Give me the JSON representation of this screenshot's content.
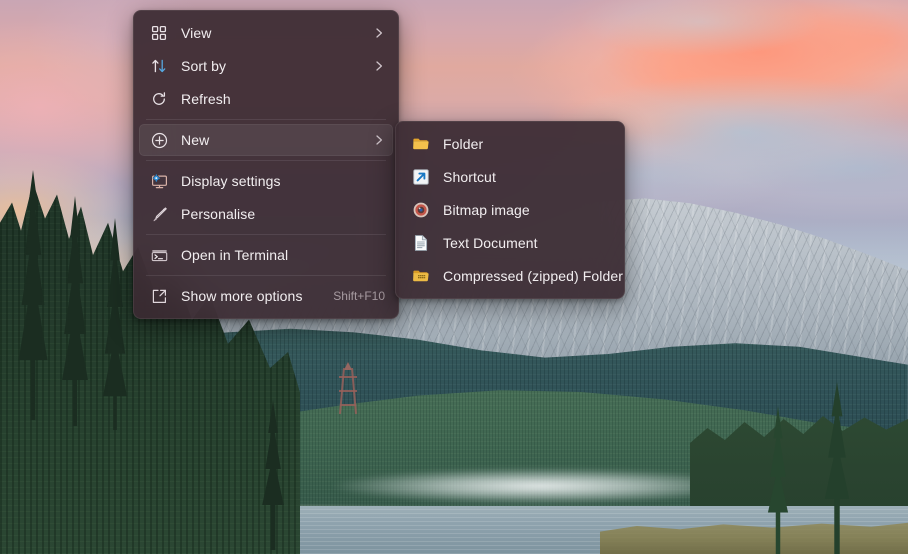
{
  "wallpaper": {
    "scene_name": "alpine-lake-sunset-wallpaper",
    "sky_colors": [
      "#d6a8ad",
      "#ff9a7a",
      "#a6b6c8",
      "#dde2e5"
    ],
    "mountain_color": "#b8c0c8",
    "forest_color": "#22382a",
    "lake_color": "#8fa3ae"
  },
  "colors": {
    "menu_background": "#3a2a32",
    "menu_text": "#f2eef0",
    "menu_accel_text": "#a79ba1",
    "menu_separator": "#4c3c44",
    "selected_row": "#4a3841",
    "accent_blue": "#2f8fd8",
    "folder_yellow": "#f0c04a"
  },
  "context_menu": {
    "name": "desktop-context-menu",
    "items": [
      {
        "id": "view",
        "label": "View",
        "icon": "grid-icon",
        "submenu": true,
        "accel": "",
        "selected": false
      },
      {
        "id": "sort-by",
        "label": "Sort by",
        "icon": "sort-arrows-icon",
        "submenu": true,
        "accel": "",
        "selected": false
      },
      {
        "id": "refresh",
        "label": "Refresh",
        "icon": "refresh-icon",
        "submenu": false,
        "accel": "",
        "selected": false
      },
      {
        "id": "new",
        "label": "New",
        "icon": "plus-circle-icon",
        "submenu": true,
        "accel": "",
        "selected": true
      },
      {
        "id": "display-settings",
        "label": "Display settings",
        "icon": "monitor-gear-icon",
        "submenu": false,
        "accel": "",
        "selected": false
      },
      {
        "id": "personalise",
        "label": "Personalise",
        "icon": "paintbrush-icon",
        "submenu": false,
        "accel": "",
        "selected": false
      },
      {
        "id": "open-in-terminal",
        "label": "Open in Terminal",
        "icon": "terminal-icon",
        "submenu": false,
        "accel": "",
        "selected": false
      },
      {
        "id": "show-more-options",
        "label": "Show more options",
        "icon": "expand-arrow-icon",
        "submenu": false,
        "accel": "Shift+F10",
        "selected": false
      }
    ],
    "separators_after": [
      "refresh",
      "new",
      "personalise",
      "open-in-terminal"
    ]
  },
  "new_submenu": {
    "name": "new-submenu",
    "items": [
      {
        "id": "folder",
        "label": "Folder",
        "icon": "folder-icon"
      },
      {
        "id": "shortcut",
        "label": "Shortcut",
        "icon": "shortcut-arrow-icon"
      },
      {
        "id": "bitmap-image",
        "label": "Bitmap image",
        "icon": "bitmap-image-icon"
      },
      {
        "id": "text-document",
        "label": "Text Document",
        "icon": "text-document-icon"
      },
      {
        "id": "compressed-folder",
        "label": "Compressed (zipped) Folder",
        "icon": "zipped-folder-icon"
      }
    ]
  }
}
